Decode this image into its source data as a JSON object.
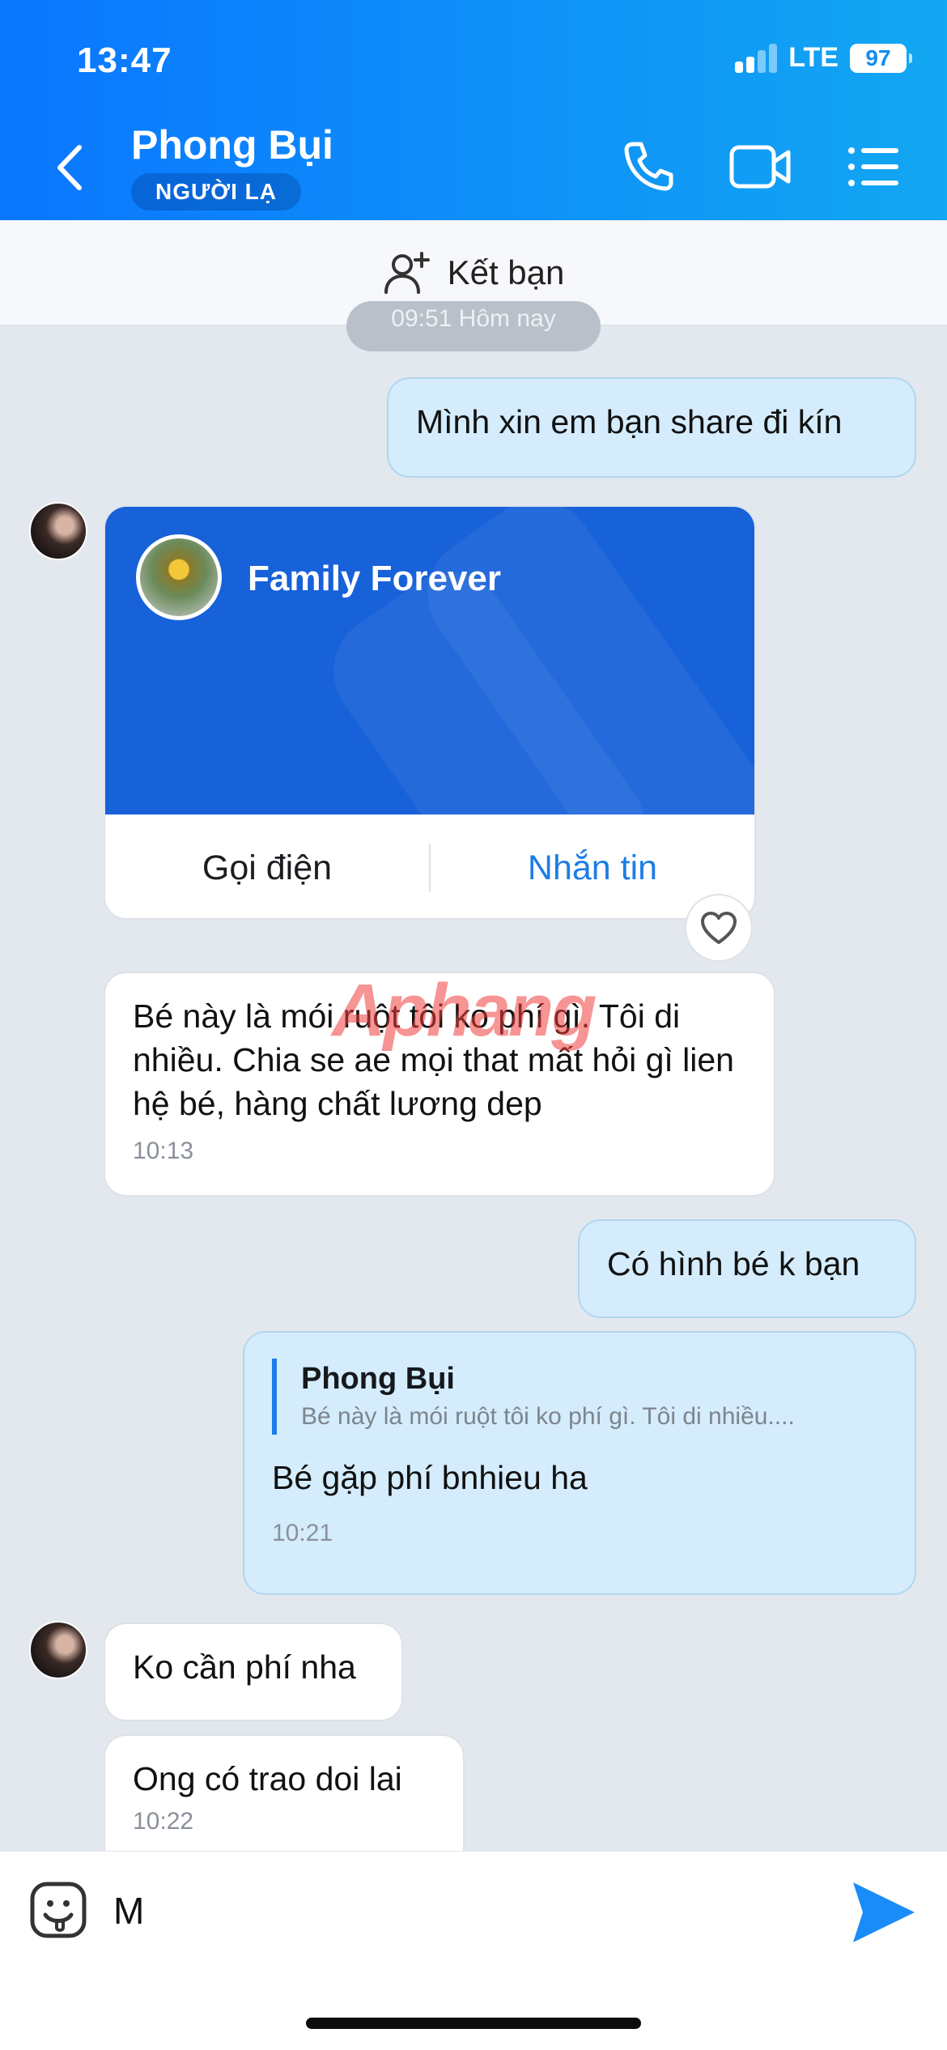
{
  "status_bar": {
    "time": "13:47",
    "network": "LTE",
    "battery": "97"
  },
  "header": {
    "contact_name": "Phong Bụi",
    "badge": "NGƯỜI LẠ"
  },
  "friend_bar": {
    "label": "Kết bạn"
  },
  "timestamp_pill": "09:51 Hôm nay",
  "messages": [
    {
      "direction": "out",
      "text": "Mình xin em bạn share đi kín"
    },
    {
      "direction": "in",
      "type": "contact_card",
      "card_name": "Family Forever",
      "call_label": "Gọi điện",
      "message_label": "Nhắn tin"
    },
    {
      "direction": "in",
      "text": "Bé này là mói ruột tôi ko phí gì. Tôi di nhiều. Chia se ae mọi that mất hỏi gì lien hệ bé, hàng chất lương dep",
      "time": "10:13"
    },
    {
      "direction": "out",
      "text": "Có hình bé k bạn"
    },
    {
      "direction": "out",
      "quote_author": "Phong Bụi",
      "quote_text": "Bé này là mói ruột tôi ko phí gì. Tôi di nhiều....",
      "text": "Bé gặp phí bnhieu ha",
      "time": "10:21"
    },
    {
      "direction": "in",
      "text": "Ko cần phí nha"
    },
    {
      "direction": "in",
      "text": "Ong có trao doi lai",
      "time": "10:22"
    }
  ],
  "watermark": "Aphang",
  "composer": {
    "value": "M"
  },
  "colors": {
    "header_start": "#0a76ff",
    "header_end": "#12a7f2",
    "outgoing_bubble": "#d4ecfc",
    "card_blue": "#1761d9",
    "link_blue": "#1d7de8"
  },
  "icons": [
    "back-chevron-icon",
    "phone-icon",
    "video-call-icon",
    "menu-list-icon",
    "add-friend-icon",
    "heart-icon",
    "sticker-icon",
    "send-icon"
  ]
}
